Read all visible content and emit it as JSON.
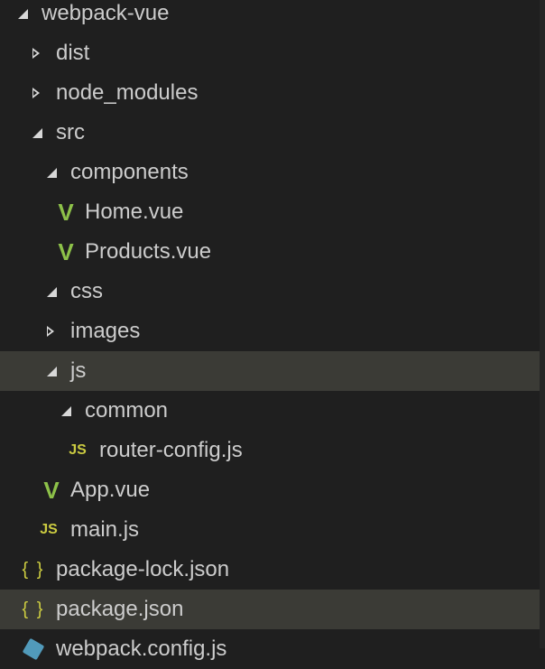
{
  "tree": [
    {
      "label": "webpack-vue",
      "type": "folder-open"
    },
    {
      "label": "dist",
      "type": "folder-closed"
    },
    {
      "label": "node_modules",
      "type": "folder-closed"
    },
    {
      "label": "src",
      "type": "folder-open"
    },
    {
      "label": "components",
      "type": "folder-open"
    },
    {
      "label": "Home.vue",
      "type": "vue-file"
    },
    {
      "label": "Products.vue",
      "type": "vue-file"
    },
    {
      "label": "css",
      "type": "folder-open"
    },
    {
      "label": "images",
      "type": "folder-closed"
    },
    {
      "label": "js",
      "type": "folder-open",
      "selected": true
    },
    {
      "label": "common",
      "type": "folder-open"
    },
    {
      "label": "router-config.js",
      "type": "js-file",
      "icon_text": "JS"
    },
    {
      "label": "App.vue",
      "type": "vue-file"
    },
    {
      "label": "main.js",
      "type": "js-file",
      "icon_text": "JS"
    },
    {
      "label": "package-lock.json",
      "type": "json-file",
      "icon_text": "{ }"
    },
    {
      "label": "package.json",
      "type": "json-file",
      "icon_text": "{ }",
      "selected": true
    },
    {
      "label": "webpack.config.js",
      "type": "webpack-file"
    }
  ],
  "colors": {
    "background": "#1f1f1f",
    "selected": "#3b3b36",
    "vue": "#8dc149",
    "js": "#cbcb41",
    "webpack": "#519aba"
  }
}
